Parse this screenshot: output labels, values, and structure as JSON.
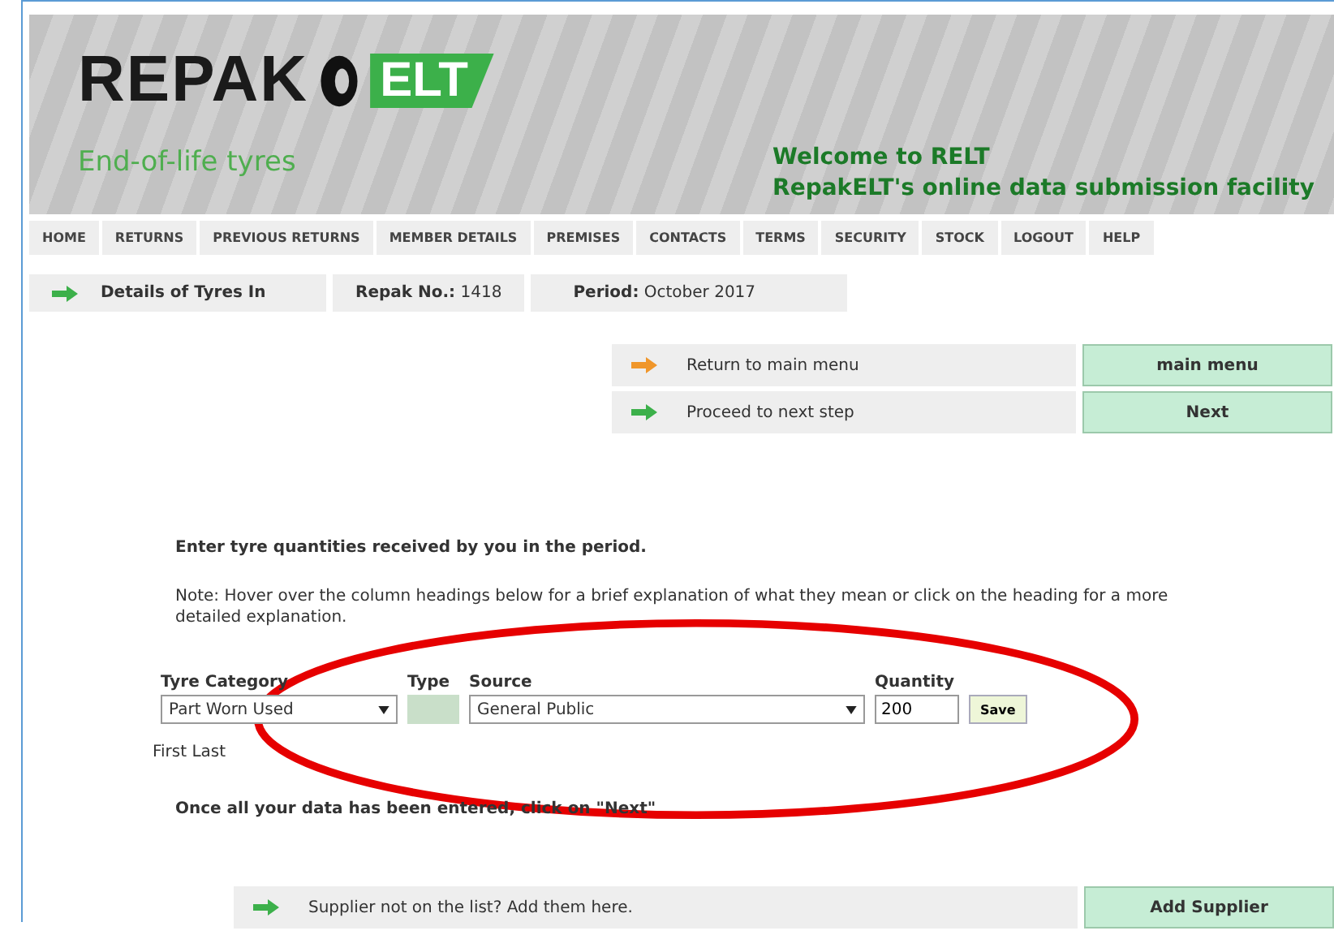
{
  "header": {
    "logo_word": "REPAK",
    "logo_badge": "ELT",
    "tagline": "End-of-life tyres",
    "welcome": "Welcome to RELT",
    "subtitle": "RepakELT's online data submission facility"
  },
  "nav": [
    "HOME",
    "RETURNS",
    "PREVIOUS RETURNS",
    "MEMBER DETAILS",
    "PREMISES",
    "CONTACTS",
    "TERMS",
    "SECURITY",
    "STOCK",
    "LOGOUT",
    "HELP"
  ],
  "details": {
    "title": "Details of Tyres In",
    "repak_label": "Repak No.:",
    "repak_value": "1418",
    "period_label": "Period:",
    "period_value": "October 2017"
  },
  "actions": [
    {
      "text": "Return to main menu",
      "button": "main menu",
      "color": "#f0962a"
    },
    {
      "text": "Proceed to next step",
      "button": "Next",
      "color": "#3cb04a"
    }
  ],
  "intro": "Enter tyre quantities received by you in the period.",
  "note": "Note: Hover over the column headings below for a brief explanation of what they mean or click on the heading for a more detailed explanation.",
  "form": {
    "columns": [
      "Tyre Category",
      "Type",
      "Source",
      "Quantity"
    ],
    "category": "Part Worn Used",
    "source": "General Public",
    "quantity": "200",
    "save": "Save"
  },
  "first_last": "First Last",
  "instruction": "Once all your data has been entered, click on \"Next\"",
  "supplier": {
    "text": "Supplier not on the list? Add them here.",
    "button": "Add Supplier",
    "color": "#3cb04a"
  }
}
